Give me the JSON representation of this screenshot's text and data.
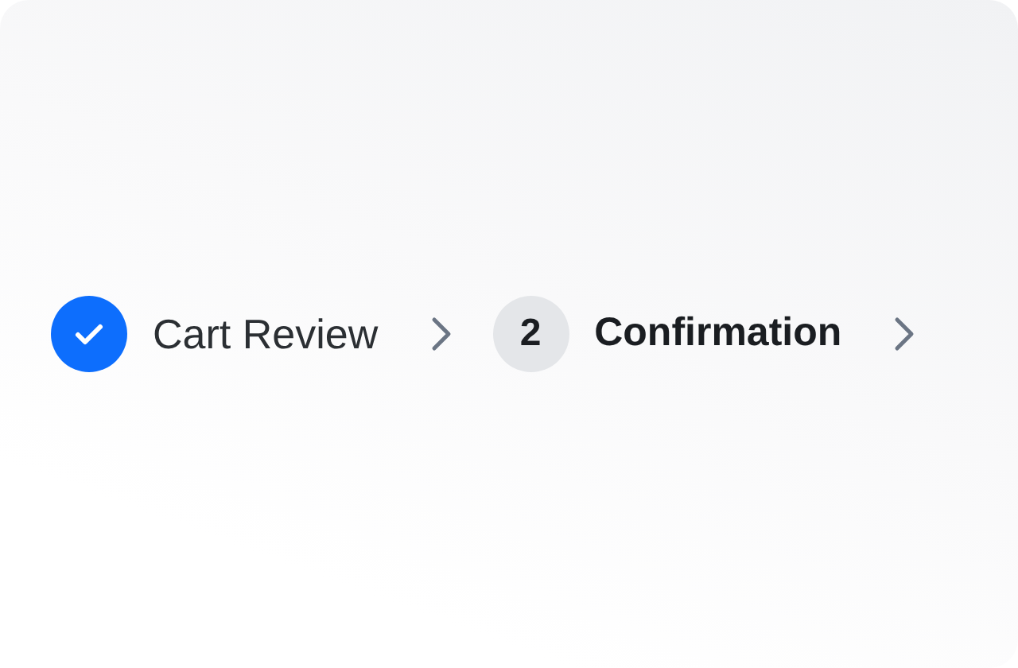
{
  "stepper": {
    "steps": [
      {
        "label": "Cart Review",
        "completed": true,
        "selected": false
      },
      {
        "label": "Confirmation",
        "number": "2",
        "completed": false,
        "selected": true
      }
    ]
  }
}
